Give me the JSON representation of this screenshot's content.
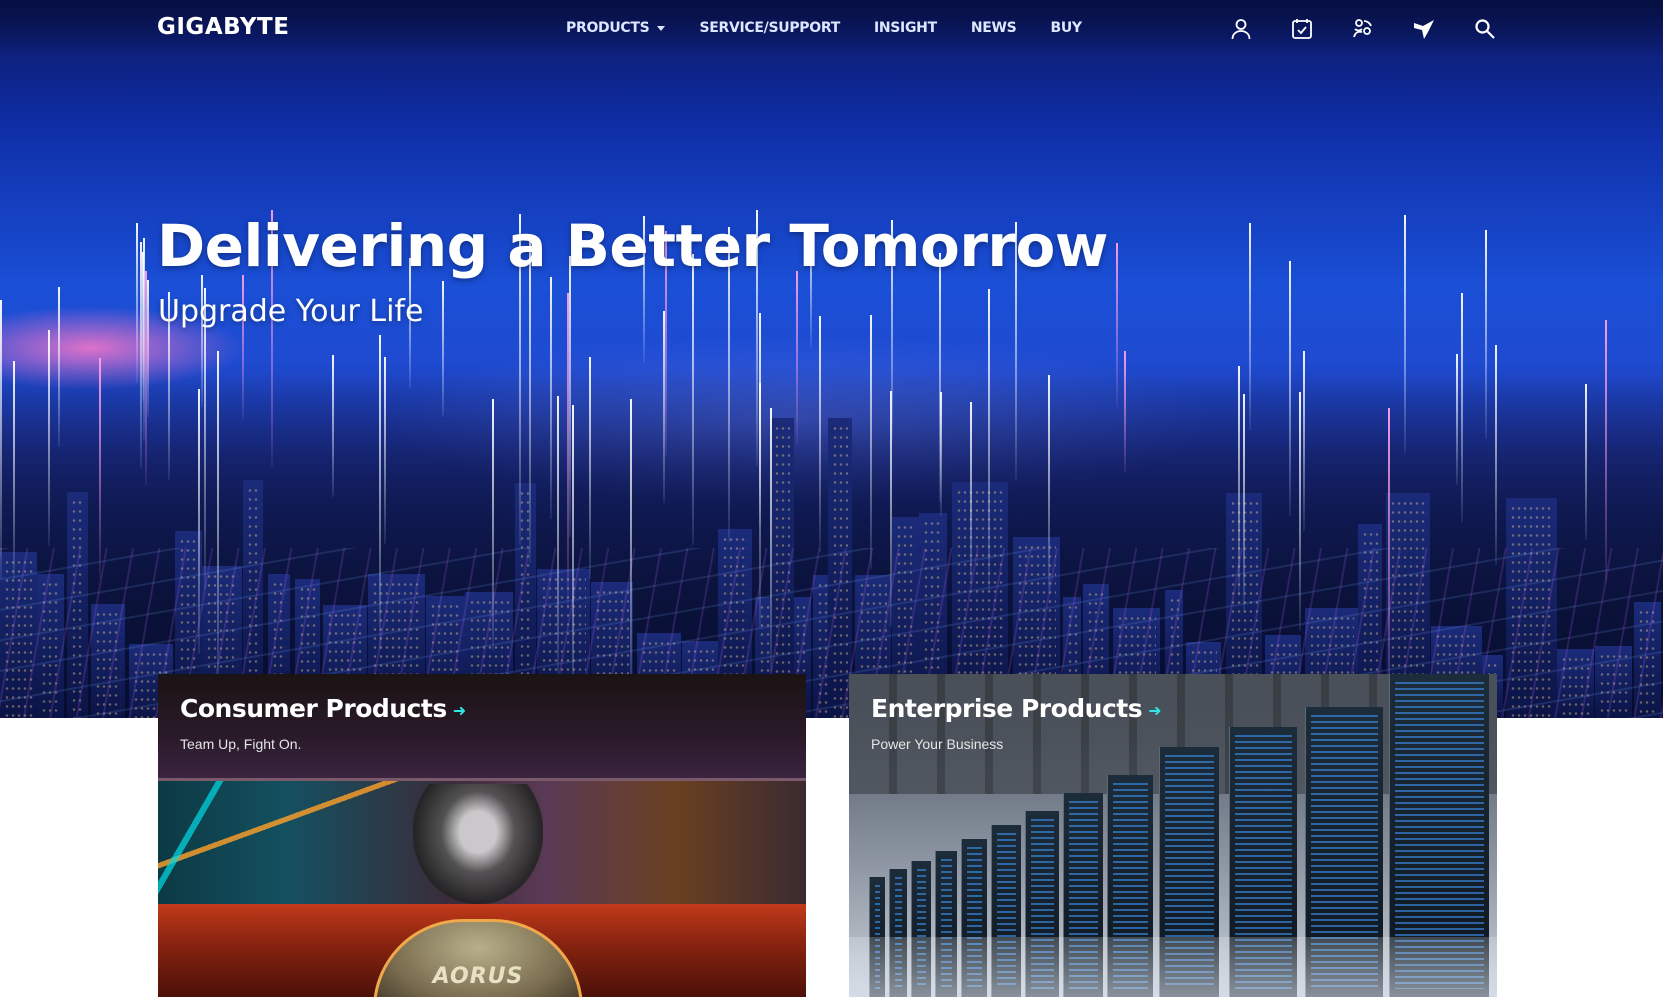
{
  "brand": {
    "logo_text": "GIGABYTE"
  },
  "nav": {
    "items": [
      {
        "label": "PRODUCTS",
        "has_dropdown": true
      },
      {
        "label": "SERVICE/SUPPORT"
      },
      {
        "label": "INSIGHT"
      },
      {
        "label": "NEWS"
      },
      {
        "label": "BUY"
      }
    ],
    "icons": [
      "user-icon",
      "compare-icon",
      "community-icon",
      "aorus-icon",
      "search-icon"
    ]
  },
  "hero": {
    "title": "Delivering a Better Tomorrow",
    "subtitle": "Upgrade Your Life"
  },
  "cards": [
    {
      "title": "Consumer Products",
      "subtitle": "Team Up, Fight On.",
      "image_text": "AORUS"
    },
    {
      "title": "Enterprise Products",
      "subtitle": "Power Your Business"
    }
  ],
  "colors": {
    "hero_blue": "#1a4fd6",
    "accent_cyan": "#2ee6e6",
    "text_white": "#ffffff"
  }
}
